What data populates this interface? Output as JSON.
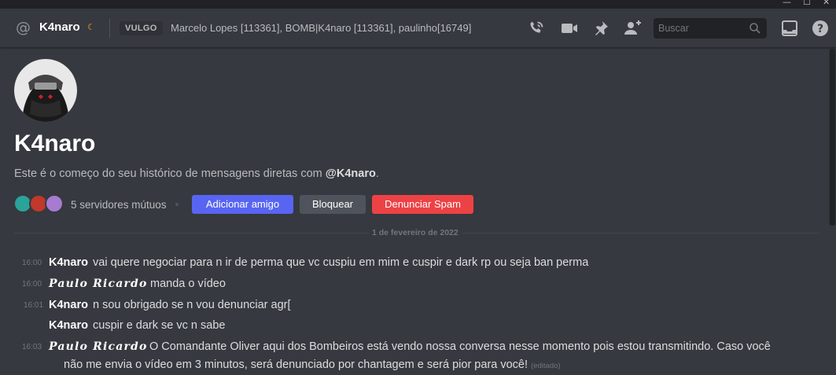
{
  "window": {
    "min": "—",
    "max": "☐",
    "close": "✕"
  },
  "header": {
    "channel_name": "K4naro",
    "tag": "VULGO",
    "members": "Marcelo Lopes [113361], BOMB|K4naro [113361], paulinho[16749]",
    "search_placeholder": "Buscar",
    "icons": [
      "at-icon",
      "moon-icon",
      "phone-call-icon",
      "video-icon",
      "pin-icon",
      "add-member-icon",
      "search-icon",
      "inbox-icon",
      "help-icon"
    ]
  },
  "profile": {
    "name": "K4naro",
    "intro_prefix": "Este é o começo do seu histórico de mensagens diretas com ",
    "intro_handle": "@K4naro",
    "intro_suffix": ".",
    "mutual_servers": "5 servidores mútuos",
    "btn_add": "Adicionar amigo",
    "btn_block": "Bloquear",
    "btn_spam": "Denunciar Spam"
  },
  "colors": {
    "blurple": "#5865f2",
    "red": "#ed4245",
    "grey_btn": "#4f545c",
    "bg": "#36393f"
  },
  "date_divider": "1 de fevereiro de 2022",
  "messages": [
    {
      "time": "16:00",
      "author": "K4naro",
      "text": "vai quere negociar para n ir de perma que vc cuspiu em mim e cuspir e dark rp ou seja ban perma"
    },
    {
      "time": "16:00",
      "author": "Paulo Ricardo",
      "text": "manda o vídeo"
    },
    {
      "time": "16:01",
      "author": "K4naro",
      "text": "n sou obrigado se n vou denunciar agr["
    },
    {
      "time": "",
      "author": "K4naro",
      "text": "cuspir e dark se vc n sabe"
    },
    {
      "time": "16:03",
      "author": "Paulo Ricardo",
      "text": "O Comandante Oliver aqui dos Bombeiros está vendo nossa conversa nesse momento pois estou transmitindo. Caso você",
      "text2": "não me envia o vídeo em 3 minutos, será denunciado por chantagem e será pior para você!",
      "edited": "(editado)"
    }
  ]
}
